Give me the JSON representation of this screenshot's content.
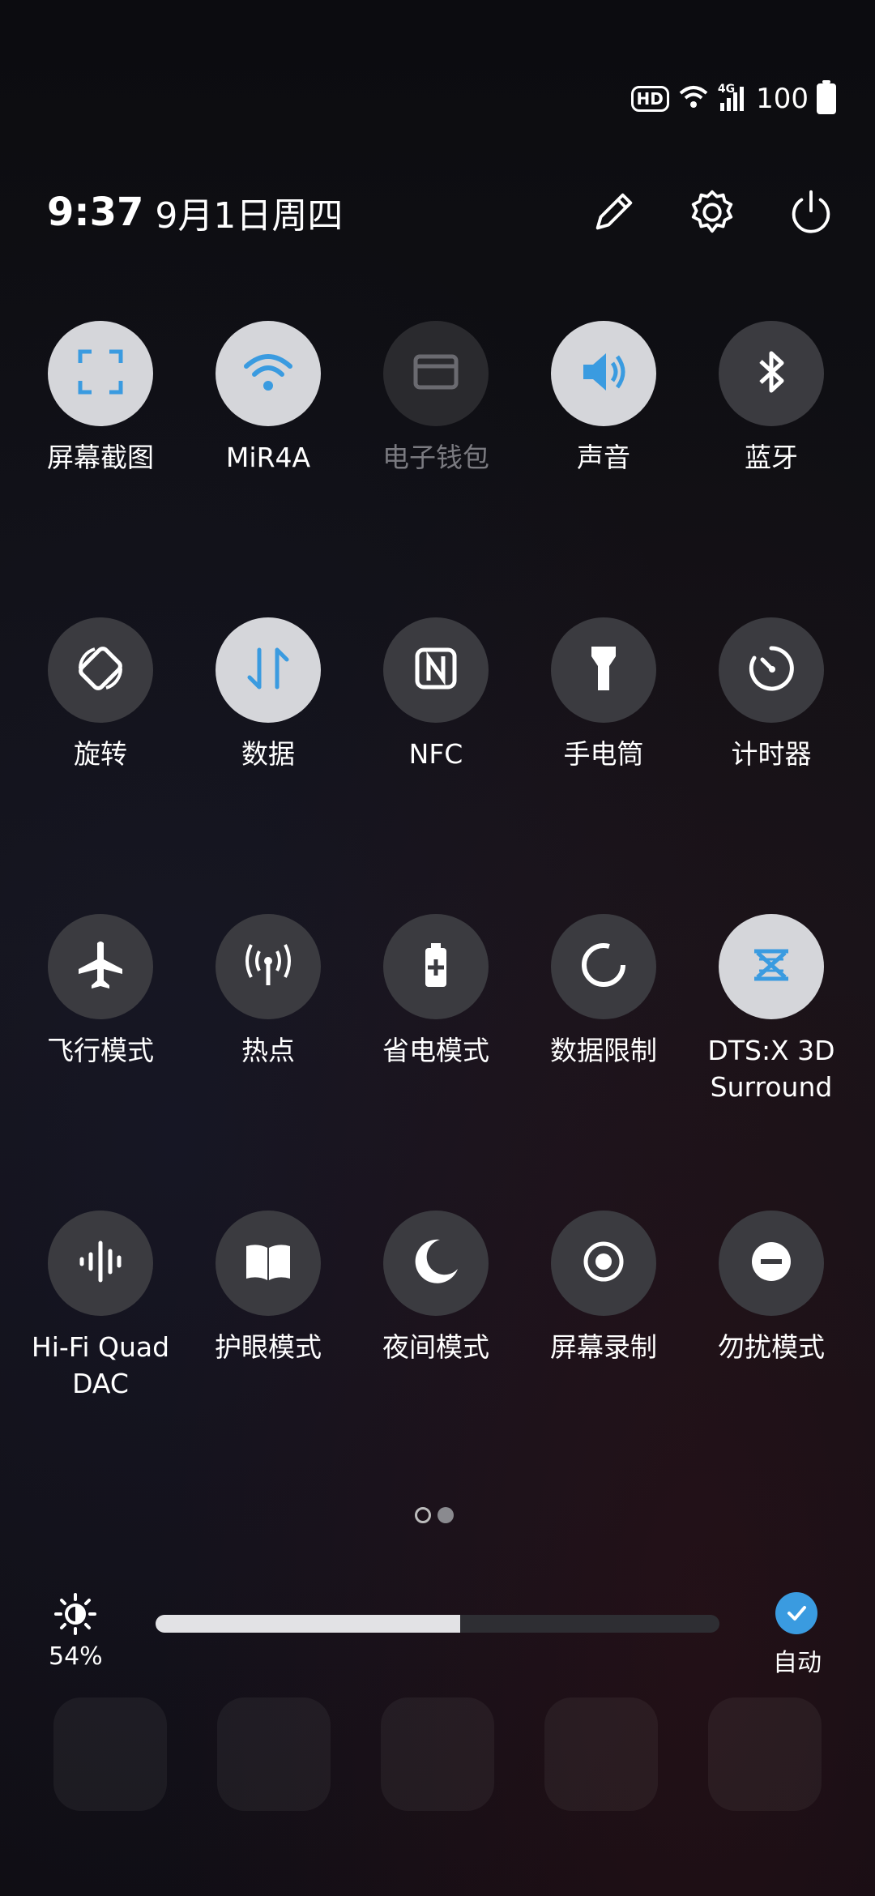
{
  "status_bar": {
    "hd_badge": "HD",
    "network_type": "4G",
    "battery_level": "100",
    "icons": [
      "wifi-icon",
      "signal-icon",
      "battery-charging-icon"
    ]
  },
  "header": {
    "time": "9:37",
    "date": "9月1日周四",
    "actions": [
      "edit-icon",
      "settings-icon",
      "power-icon"
    ]
  },
  "tiles": [
    [
      {
        "label": "屏幕截图",
        "icon": "screenshot-icon",
        "state": "on"
      },
      {
        "label": "MiR4A",
        "icon": "wifi-icon",
        "state": "on"
      },
      {
        "label": "电子钱包",
        "icon": "wallet-icon",
        "state": "disabled"
      },
      {
        "label": "声音",
        "icon": "sound-icon",
        "state": "on"
      },
      {
        "label": "蓝牙",
        "icon": "bluetooth-icon",
        "state": "off"
      }
    ],
    [
      {
        "label": "旋转",
        "icon": "rotate-icon",
        "state": "off"
      },
      {
        "label": "数据",
        "icon": "mobile-data-icon",
        "state": "on"
      },
      {
        "label": "NFC",
        "icon": "nfc-icon",
        "state": "off"
      },
      {
        "label": "手电筒",
        "icon": "flashlight-icon",
        "state": "off"
      },
      {
        "label": "计时器",
        "icon": "timer-icon",
        "state": "off"
      }
    ],
    [
      {
        "label": "飞行模式",
        "icon": "airplane-icon",
        "state": "off"
      },
      {
        "label": "热点",
        "icon": "hotspot-icon",
        "state": "off"
      },
      {
        "label": "省电模式",
        "icon": "battery-saver-icon",
        "state": "off"
      },
      {
        "label": "数据限制",
        "icon": "data-limit-icon",
        "state": "off"
      },
      {
        "label": "DTS:X 3D\nSurround",
        "icon": "dtsx-icon",
        "state": "on"
      }
    ],
    [
      {
        "label": "Hi-Fi Quad\nDAC",
        "icon": "hifi-icon",
        "state": "off"
      },
      {
        "label": "护眼模式",
        "icon": "eye-care-icon",
        "state": "off"
      },
      {
        "label": "夜间模式",
        "icon": "night-mode-icon",
        "state": "off"
      },
      {
        "label": "屏幕录制",
        "icon": "screen-record-icon",
        "state": "off"
      },
      {
        "label": "勿扰模式",
        "icon": "dnd-icon",
        "state": "off"
      }
    ]
  ],
  "pager": {
    "pages": 2,
    "current": 1
  },
  "brightness": {
    "percent_label": "54%",
    "level": 0.54,
    "auto_label": "自动",
    "auto_enabled": true
  },
  "colors": {
    "accent": "#3a9be0",
    "tile_on": "#d5d6da",
    "tile_off": "#3b3b40"
  }
}
